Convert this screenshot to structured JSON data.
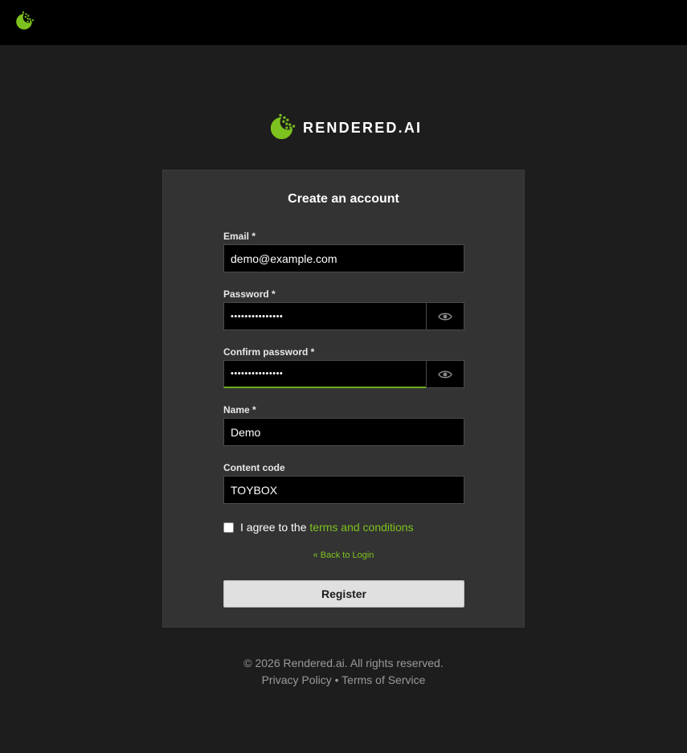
{
  "topbar": {
    "logo_icon": "rendered-ai-logo-icon"
  },
  "brand": {
    "wordmark": "RENDERED.AI",
    "accent_color": "#7dc21e"
  },
  "form": {
    "title": "Create an account",
    "email": {
      "label": "Email *",
      "value": "demo@example.com"
    },
    "password": {
      "label": "Password *",
      "value": "•••••••••••••••"
    },
    "confirm_password": {
      "label": "Confirm password *",
      "value": "•••••••••••••••"
    },
    "name": {
      "label": "Name *",
      "value": "Demo"
    },
    "content_code": {
      "label": "Content code",
      "value": "TOYBOX"
    },
    "show_password_icon": "eye-icon",
    "agree_prefix": "I agree to the ",
    "agree_link": "terms and conditions",
    "agree_checked": false,
    "back_link": "« Back to Login",
    "register_label": "Register"
  },
  "footer": {
    "copyright": "© 2026 Rendered.ai. All rights reserved.",
    "privacy": "Privacy Policy",
    "separator": " • ",
    "terms": "Terms of Service"
  }
}
